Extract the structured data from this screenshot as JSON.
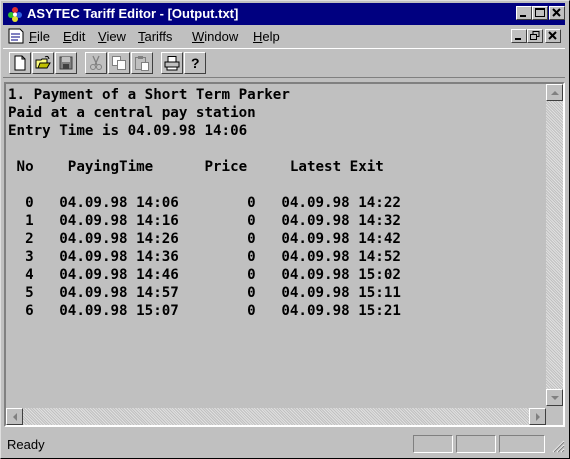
{
  "window": {
    "title": "ASYTEC Tariff Editor - [Output.txt]",
    "controls": {
      "minimize": "_",
      "maximize": "□",
      "close": "×"
    }
  },
  "menu": {
    "items": [
      {
        "label": "File",
        "accel": "F",
        "rest": "ile"
      },
      {
        "label": "Edit",
        "accel": "E",
        "rest": "dit"
      },
      {
        "label": "View",
        "accel": "V",
        "rest": "iew"
      },
      {
        "label": "Tariffs",
        "accel": "T",
        "rest": "ariffs"
      },
      {
        "label": "Window",
        "accel": "W",
        "rest": "indow"
      },
      {
        "label": "Help",
        "accel": "H",
        "rest": "elp"
      }
    ]
  },
  "toolbar": {
    "icons": [
      "new-file-icon",
      "open-folder-icon",
      "save-disk-icon",
      "cut-scissors-icon",
      "copy-icon",
      "paste-icon",
      "print-icon",
      "help-icon"
    ]
  },
  "document": {
    "lines": [
      "1. Payment of a Short Term Parker",
      "Paid at a central pay station",
      "Entry Time is 04.09.98 14:06",
      "",
      " No    PayingTime      Price     Latest Exit",
      "",
      "  0   04.09.98 14:06        0   04.09.98 14:22",
      "  1   04.09.98 14:16        0   04.09.98 14:32",
      "  2   04.09.98 14:26        0   04.09.98 14:42",
      "  3   04.09.98 14:36        0   04.09.98 14:52",
      "  4   04.09.98 14:46        0   04.09.98 15:02",
      "  5   04.09.98 14:57        0   04.09.98 15:11",
      "  6   04.09.98 15:07        0   04.09.98 15:21"
    ]
  },
  "status": {
    "text": "Ready"
  },
  "colors": {
    "titlebar": "#000080",
    "face": "#c0c0c0"
  }
}
